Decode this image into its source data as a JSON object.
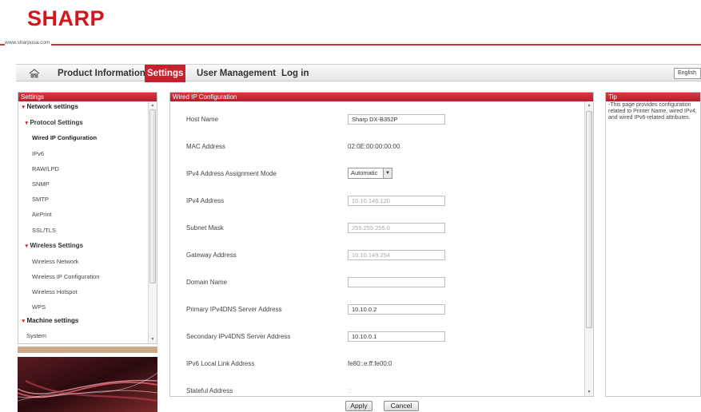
{
  "brand": {
    "logo_text": "SHARP",
    "url": "www.sharpusa.com"
  },
  "nav": {
    "items": [
      {
        "label": "Product Information",
        "active": false
      },
      {
        "label": "Settings",
        "active": true
      },
      {
        "label": "User Management",
        "active": false
      },
      {
        "label": "Log in",
        "active": false
      }
    ],
    "language": "English"
  },
  "sidebar": {
    "title": "Settings",
    "items": [
      {
        "label": "Network settings",
        "level": 1,
        "expanded": true
      },
      {
        "label": "Protocol Settings",
        "level": 2,
        "expanded": true
      },
      {
        "label": "Wired IP Configuration",
        "level": 3,
        "selected": true
      },
      {
        "label": "IPv6",
        "level": 3
      },
      {
        "label": "RAW/LPD",
        "level": 3
      },
      {
        "label": "SNMP",
        "level": 3
      },
      {
        "label": "SMTP",
        "level": 3
      },
      {
        "label": "AirPrint",
        "level": 3
      },
      {
        "label": "SSL/TLS",
        "level": 3
      },
      {
        "label": "Wireless Settings",
        "level": 2,
        "expanded": true
      },
      {
        "label": "Wireless Network",
        "level": 3
      },
      {
        "label": "Wireless IP Configuration",
        "level": 3
      },
      {
        "label": "Wireless Hotspot",
        "level": 3
      },
      {
        "label": "WPS",
        "level": 3
      },
      {
        "label": "Machine settings",
        "level": 1,
        "expanded": true
      },
      {
        "label": "System",
        "level": 2
      }
    ]
  },
  "main": {
    "title": "Wired IP Configuration",
    "fields": [
      {
        "label": "Host Name",
        "kind": "input",
        "value": "Sharp DX-B352P"
      },
      {
        "label": "MAC Address",
        "kind": "text",
        "value": "02:0E:00:00:00:00"
      },
      {
        "label": "IPv4 Address Assignment Mode",
        "kind": "select",
        "value": "Automatic"
      },
      {
        "label": "IPv4 Address",
        "kind": "input-disabled",
        "value": "10.10.146.120"
      },
      {
        "label": "Subnet Mask",
        "kind": "input-disabled",
        "value": "255.255.255.0"
      },
      {
        "label": "Gateway Address",
        "kind": "input-disabled",
        "value": "10.10.149.254"
      },
      {
        "label": "Domain Name",
        "kind": "input",
        "value": ""
      },
      {
        "label": "Primary IPv4DNS Server Address",
        "kind": "input",
        "value": "10.10.0.2"
      },
      {
        "label": "Secondary IPv4DNS Server Address",
        "kind": "input",
        "value": "10.10.0.1"
      },
      {
        "label": "IPv6 Local Link Address",
        "kind": "text",
        "value": "fe80::e:ff:fe00:0"
      },
      {
        "label": "Stateful Address",
        "kind": "text",
        "value": "::"
      }
    ],
    "apply_label": "Apply",
    "cancel_label": "Cancel"
  },
  "tip": {
    "title": "Tip",
    "text": "-This page provides configuration related to Printer Name, wired IPv4, and wired IPv6-related attributes."
  },
  "colors": {
    "accent": "#c8202d",
    "brand_red": "#d6141b",
    "divider": "#c23a3a"
  }
}
